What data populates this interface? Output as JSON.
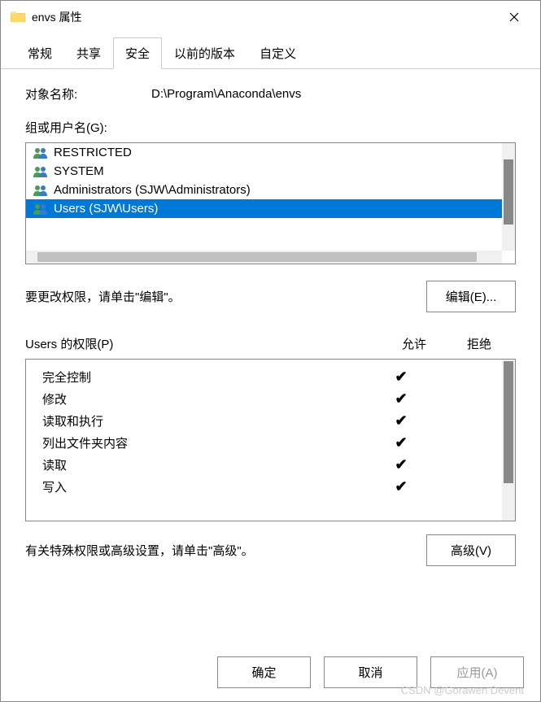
{
  "title": "envs 属性",
  "tabs": [
    "常规",
    "共享",
    "安全",
    "以前的版本",
    "自定义"
  ],
  "active_tab": 2,
  "object_name_label": "对象名称:",
  "object_name_value": "D:\\Program\\Anaconda\\envs",
  "groups_label": "组或用户名(G):",
  "groups": [
    "RESTRICTED",
    "SYSTEM",
    "Administrators (SJW\\Administrators)",
    "Users (SJW\\Users)"
  ],
  "selected_group_index": 3,
  "edit_hint": "要更改权限，请单击\"编辑\"。",
  "edit_button": "编辑(E)...",
  "perm_label": "Users 的权限(P)",
  "perm_cols": {
    "allow": "允许",
    "deny": "拒绝"
  },
  "permissions": [
    {
      "name": "完全控制",
      "allow": true,
      "deny": false
    },
    {
      "name": "修改",
      "allow": true,
      "deny": false
    },
    {
      "name": "读取和执行",
      "allow": true,
      "deny": false
    },
    {
      "name": "列出文件夹内容",
      "allow": true,
      "deny": false
    },
    {
      "name": "读取",
      "allow": true,
      "deny": false
    },
    {
      "name": "写入",
      "allow": true,
      "deny": false
    }
  ],
  "adv_hint": "有关特殊权限或高级设置，请单击\"高级\"。",
  "adv_button": "高级(V)",
  "footer": {
    "ok": "确定",
    "cancel": "取消",
    "apply": "应用(A)"
  },
  "watermark": "CSDN @Gorawen Devent"
}
